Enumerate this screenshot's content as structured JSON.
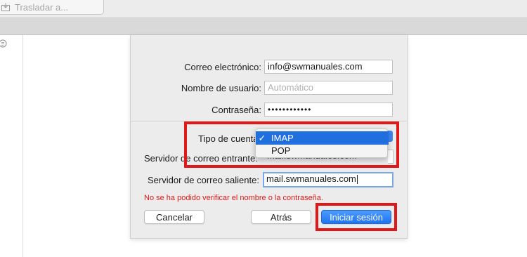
{
  "toolbar": {
    "move_button_label": "Trasladar a..."
  },
  "form": {
    "email_label": "Correo electrónico:",
    "email_value": "info@swmanuales.com",
    "username_label": "Nombre de usuario:",
    "username_placeholder": "Automático",
    "password_label": "Contraseña:",
    "password_value": "••••••••••••",
    "account_type_label": "Tipo de cuenta",
    "incoming_label": "Servidor de correo entrante:",
    "incoming_value": "mail.swmanuales.com",
    "outgoing_label": "Servidor de correo saliente:",
    "outgoing_value": "mail.swmanuales.com",
    "error_message": "No se ha podido verificar el nombre o la contraseña."
  },
  "account_type_menu": {
    "options": [
      {
        "label": "IMAP",
        "selected": true,
        "check": "✓"
      },
      {
        "label": "POP",
        "selected": false,
        "check": ""
      }
    ]
  },
  "buttons": {
    "cancel": "Cancelar",
    "back": "Atrás",
    "sign_in": "Iniciar sesión"
  },
  "colors": {
    "highlight": "#e01818",
    "accent": "#1f6fde",
    "error": "#e01818"
  }
}
